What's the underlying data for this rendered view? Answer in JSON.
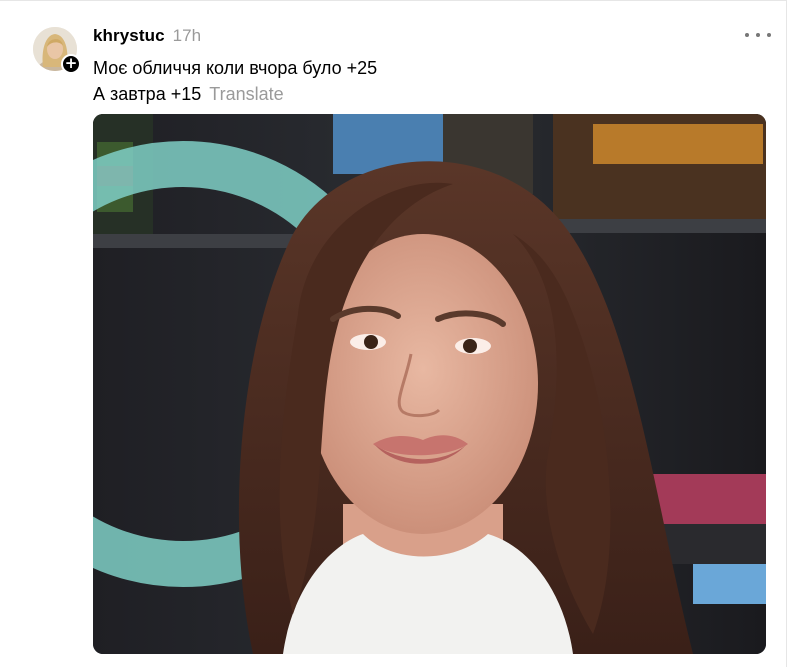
{
  "post": {
    "username": "khrystuc",
    "timestamp": "17h",
    "caption_line1": "Моє обличчя коли вчора було +25",
    "caption_line2": "А завтра +15",
    "translate_label": "Translate",
    "follow_badge": "+"
  },
  "icons": {
    "more": "more-options-icon",
    "follow": "plus-icon"
  },
  "colors": {
    "text_primary": "#000000",
    "text_secondary": "#9a9a9a",
    "badge_bg": "#000000"
  }
}
